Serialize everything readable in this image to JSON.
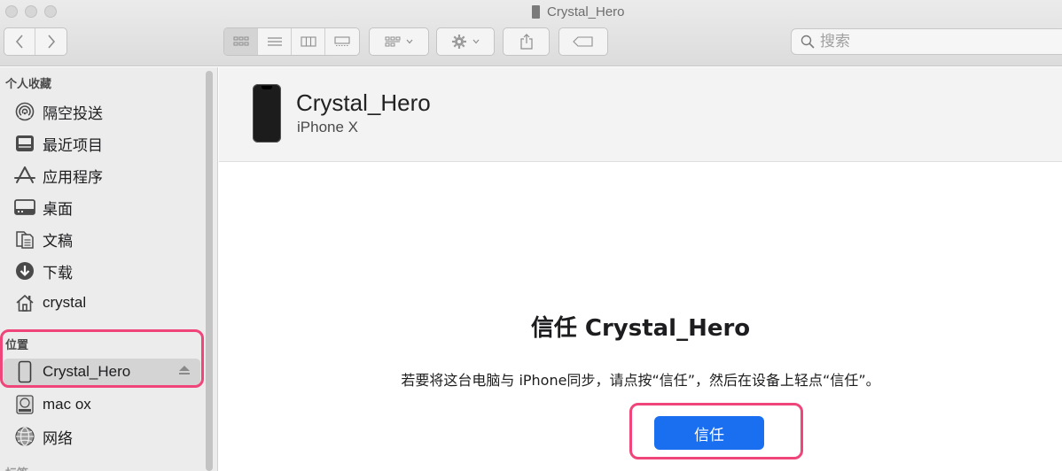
{
  "window": {
    "title": "Crystal_Hero"
  },
  "search": {
    "placeholder": "搜索"
  },
  "sidebar": {
    "favorites_title": "个人收藏",
    "favorites": [
      {
        "label": "隔空投送",
        "icon": "airdrop-icon"
      },
      {
        "label": "最近项目",
        "icon": "recents-icon"
      },
      {
        "label": "应用程序",
        "icon": "applications-icon"
      },
      {
        "label": "桌面",
        "icon": "desktop-icon"
      },
      {
        "label": "文稿",
        "icon": "documents-icon"
      },
      {
        "label": "下载",
        "icon": "downloads-icon"
      },
      {
        "label": "crystal",
        "icon": "home-icon"
      }
    ],
    "locations_title": "位置",
    "locations": [
      {
        "label": "Crystal_Hero",
        "icon": "iphone-icon",
        "selected": true
      },
      {
        "label": "mac ox",
        "icon": "disk-icon"
      },
      {
        "label": "网络",
        "icon": "network-icon"
      }
    ],
    "tags_title_partial": "标签"
  },
  "device": {
    "name": "Crystal_Hero",
    "model": "iPhone X"
  },
  "trust_prompt": {
    "title": "信任 Crystal_Hero",
    "description": "若要将这台电脑与 iPhone同步，请点按“信任”，然后在设备上轻点“信任”。",
    "button_label": "信任"
  },
  "colors": {
    "accent": "#1a6ff1",
    "highlight": "#f0457a",
    "sidebar_bg": "#ececec"
  }
}
